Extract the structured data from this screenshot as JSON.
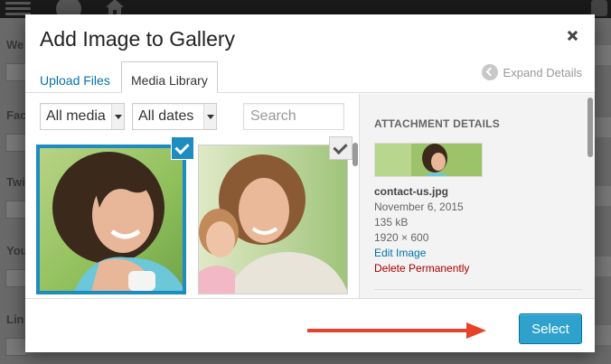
{
  "modal": {
    "title": "Add Image to Gallery",
    "tabs": [
      {
        "label": "Upload Files",
        "active": false
      },
      {
        "label": "Media Library",
        "active": true
      }
    ],
    "expand_details": "Expand Details",
    "close_icon": "close-icon"
  },
  "filters": {
    "media_type": "All media",
    "dates": "All dates",
    "search_placeholder": "Search"
  },
  "attachments": [
    {
      "selected": true,
      "description": "woman smiling with phone"
    },
    {
      "selected": false,
      "description": "woman and child smiling"
    }
  ],
  "attachment_details": {
    "heading": "Attachment Details",
    "filename": "contact-us.jpg",
    "date": "November 6, 2015",
    "size": "135 kB",
    "dimensions": "1920 × 600",
    "edit_link": "Edit Image",
    "delete_link": "Delete Permanently"
  },
  "footer": {
    "select_label": "Select"
  },
  "colors": {
    "accent": "#0073aa",
    "button": "#2ea2cc",
    "delete": "#aa0000",
    "selected_outline": "#1e8cbe",
    "annotation_arrow": "#e8412a"
  }
}
